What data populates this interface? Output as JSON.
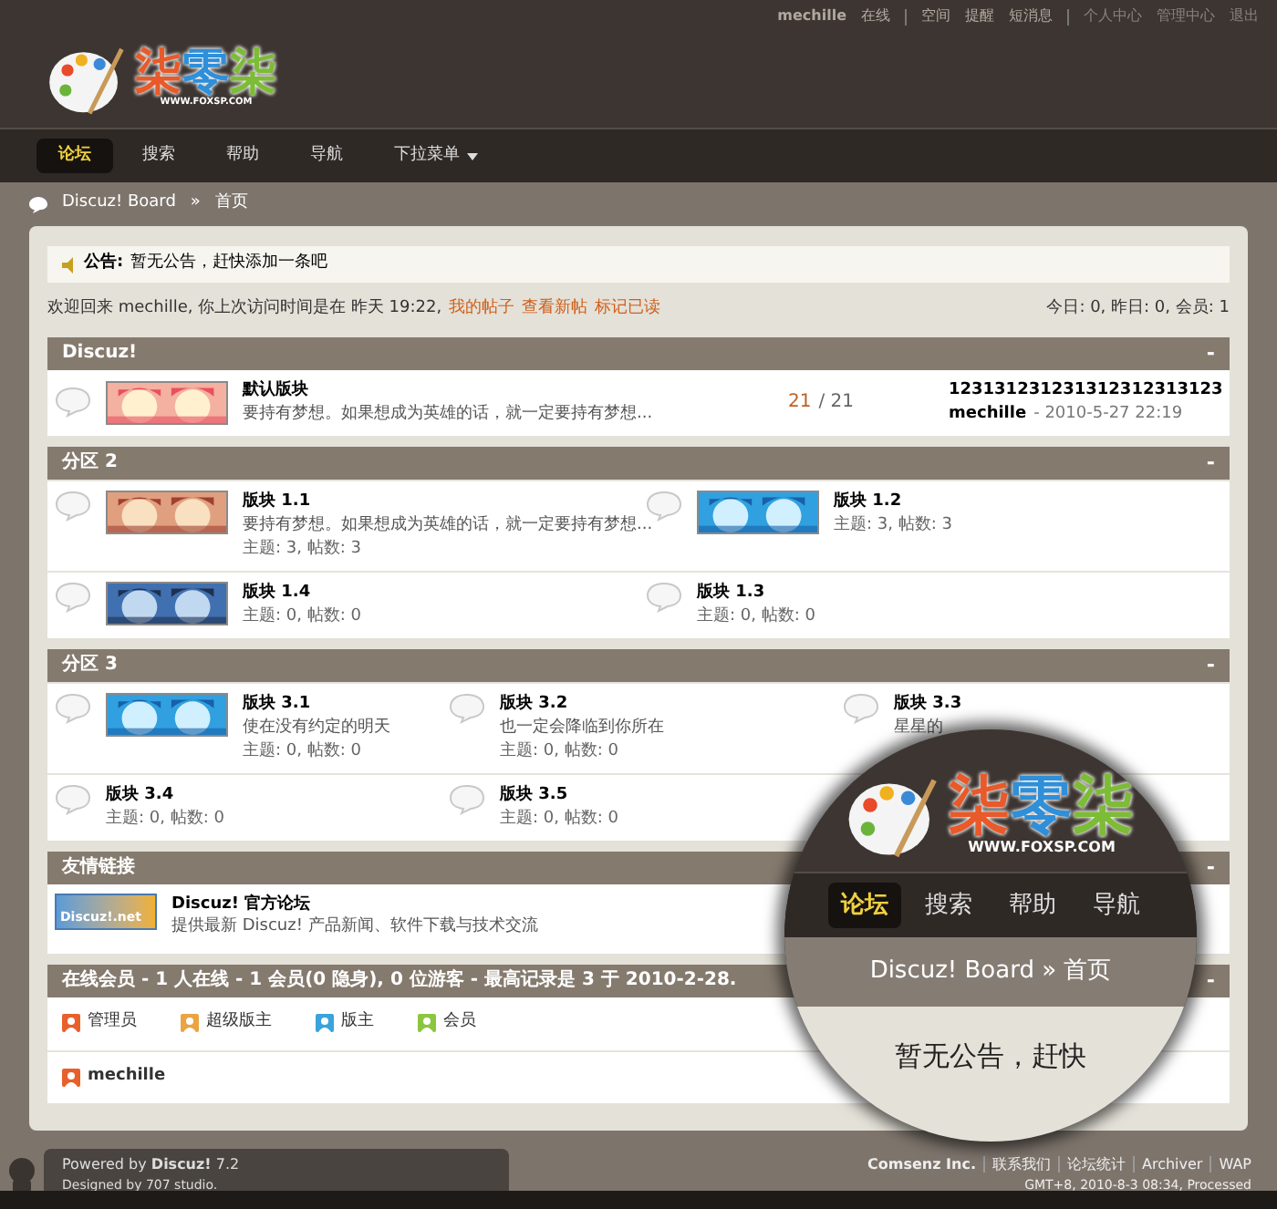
{
  "top_bar": {
    "user": "mechille",
    "status": "在线",
    "links": [
      "空间",
      "提醒",
      "短消息"
    ],
    "account_links": [
      "个人中心",
      "管理中心",
      "退出"
    ]
  },
  "logo": {
    "chars": [
      "柒",
      "零",
      "柒"
    ],
    "url": "WWW.FOXSP.COM"
  },
  "nav": [
    {
      "label": "论坛",
      "selected": true,
      "dropdown": false
    },
    {
      "label": "搜索",
      "selected": false,
      "dropdown": false
    },
    {
      "label": "帮助",
      "selected": false,
      "dropdown": false
    },
    {
      "label": "导航",
      "selected": false,
      "dropdown": false
    },
    {
      "label": "下拉菜单",
      "selected": false,
      "dropdown": true
    }
  ],
  "breadcrumb": {
    "items": [
      "Discuz! Board",
      "首页"
    ],
    "separator": "»"
  },
  "announcement": {
    "label": "公告:",
    "text": "暂无公告，赶快添加一条吧"
  },
  "welcome": {
    "text": "欢迎回来 mechille, 你上次访问时间是在 昨天 19:22,",
    "links": [
      "我的帖子",
      "查看新帖",
      "标记已读"
    ],
    "stats": "今日: 0, 昨日: 0, 会员: 1"
  },
  "sections": [
    {
      "kind": "list",
      "title": "Discuz!",
      "toggle": "-",
      "forums": [
        {
          "name": "默认版块",
          "picture": true,
          "desc": "要持有梦想。如果想成为英雄的话，就一定要持有梦想...",
          "posts_today": "21",
          "posts_total": "/ 21",
          "last_title": "123131231231312312313123",
          "last_user": "mechille",
          "last_time": "- 2010-5-27 22:19"
        }
      ]
    },
    {
      "kind": "grid",
      "title": "分区 2",
      "toggle": "-",
      "rows": [
        [
          {
            "name": "版块 1.1",
            "picture": true,
            "desc": "要持有梦想。如果想成为英雄的话，就一定要持有梦想...",
            "stats": "主题: 3, 帖数: 3"
          },
          {
            "name": "版块 1.2",
            "picture": true,
            "stats": "主题: 3, 帖数: 3"
          }
        ],
        [
          {
            "name": "版块 1.4",
            "picture": true,
            "stats": "主题: 0, 帖数: 0"
          },
          {
            "name": "版块 1.3",
            "picture": false,
            "stats": "主题: 0, 帖数: 0"
          }
        ]
      ]
    },
    {
      "kind": "grid",
      "title": "分区 3",
      "toggle": "-",
      "rows": [
        [
          {
            "name": "版块 3.1",
            "picture": true,
            "desc": "使在没有约定的明天",
            "stats": "主题: 0, 帖数: 0"
          },
          {
            "name": "版块 3.2",
            "picture": false,
            "desc": "也一定会降临到你所在",
            "stats": "主题: 0, 帖数: 0"
          },
          {
            "name": "版块 3.3",
            "picture": false,
            "desc": "星星的"
          }
        ],
        [
          {
            "name": "版块 3.4",
            "picture": false,
            "stats": "主题: 0, 帖数: 0"
          },
          {
            "name": "版块 3.5",
            "picture": false,
            "stats": "主题: 0, 帖数: 0"
          }
        ]
      ]
    },
    {
      "kind": "links",
      "title": "友情链接",
      "toggle": "-",
      "links": [
        {
          "badge": "Discuz!.net",
          "name": "Discuz! 官方论坛",
          "desc": "提供最新 Discuz! 产品新闻、软件下载与技术交流"
        }
      ]
    },
    {
      "kind": "online",
      "title": "在线会员 - 1 人在线 - 1 会员(0 隐身), 0 位游客 - 最高记录是 3 于 2010-2-28.",
      "toggle": "-",
      "legend": [
        {
          "label": "管理员",
          "color": "#e8602c"
        },
        {
          "label": "超级版主",
          "color": "#eaa443"
        },
        {
          "label": "版主",
          "color": "#3aa3dc"
        },
        {
          "label": "会员",
          "color": "#8cc63e"
        }
      ],
      "members": [
        {
          "name": "mechille",
          "color": "#e8602c"
        }
      ]
    }
  ],
  "footer": {
    "powered": "Powered by **Discuz!** 7.2",
    "designed": "Designed by 707 studio.",
    "links": [
      "Comsenz Inc.",
      "联系我们",
      "论坛统计",
      "Archiver",
      "WAP"
    ],
    "info": "GMT+8, 2010-8-3 08:34, Processed"
  },
  "magnifier": {
    "logo": {
      "chars": [
        "柒",
        "零",
        "柒"
      ],
      "url": "WWW.FOXSP.COM"
    },
    "nav": [
      {
        "label": "论坛",
        "selected": true
      },
      {
        "label": "搜索",
        "selected": false
      },
      {
        "label": "帮助",
        "selected": false
      },
      {
        "label": "导航",
        "selected": false
      }
    ],
    "breadcrumb": "Discuz! Board » 首页",
    "announcement": "暂无公告，赶快"
  }
}
